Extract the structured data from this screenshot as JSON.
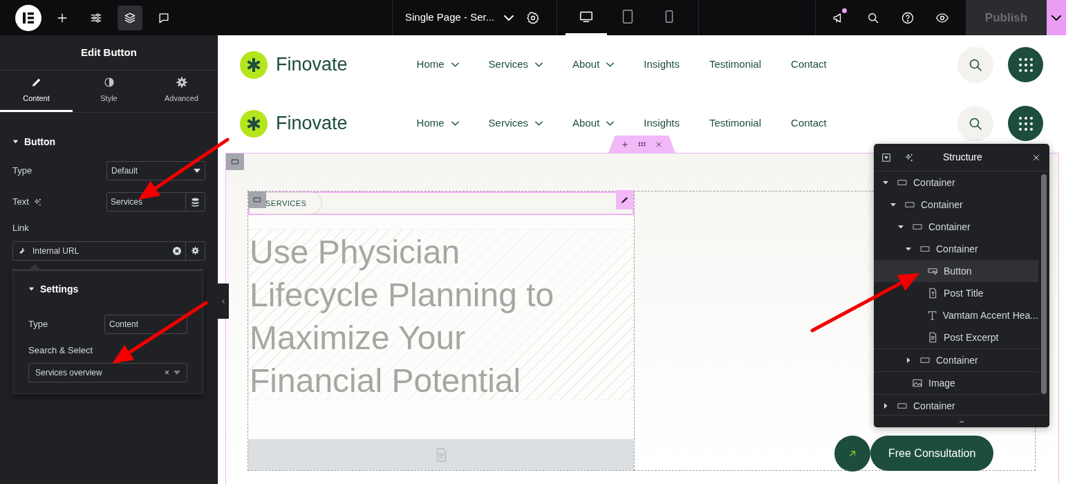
{
  "top_bar": {
    "tools": [
      {
        "kind": "add",
        "selected": false
      },
      {
        "kind": "sliders",
        "selected": false
      },
      {
        "kind": "layers",
        "selected": true
      },
      {
        "kind": "comments",
        "selected": false
      }
    ],
    "page_title": "Single Page - Ser...",
    "devices": [
      {
        "kind": "desktop",
        "selected": true
      },
      {
        "kind": "tablet",
        "selected": false
      },
      {
        "kind": "mobile",
        "selected": false
      }
    ],
    "has_notification": true,
    "publish": {
      "label": "Publish",
      "disabled": true
    }
  },
  "panel": {
    "title": "Edit Button",
    "tabs": [
      {
        "kind": "content",
        "label": "Content",
        "selected": true
      },
      {
        "kind": "style",
        "label": "Style",
        "selected": false
      },
      {
        "kind": "advanced",
        "label": "Advanced",
        "selected": false
      }
    ],
    "section": {
      "title": "Button",
      "expanded": true
    },
    "type": {
      "label": "Type",
      "value": "Default"
    },
    "text": {
      "label": "Text",
      "value": "Services"
    },
    "link": {
      "label": "Link",
      "value": "Internal URL"
    },
    "settings": {
      "title": "Settings",
      "expanded": true,
      "type": {
        "label": "Type",
        "value": "Content"
      },
      "search": {
        "label": "Search & Select",
        "value": "Services overview",
        "clear": "×"
      }
    }
  },
  "headers": [
    {
      "logo": "Finovate",
      "nav": [
        {
          "label": "Home",
          "has_dropdown": true
        },
        {
          "label": "Services",
          "has_dropdown": true
        },
        {
          "label": "About",
          "has_dropdown": true
        },
        {
          "label": "Insights",
          "has_dropdown": false
        },
        {
          "label": "Testimonial",
          "has_dropdown": false
        },
        {
          "label": "Contact",
          "has_dropdown": false
        }
      ]
    },
    {
      "logo": "Finovate",
      "nav": [
        {
          "label": "Home",
          "has_dropdown": true
        },
        {
          "label": "Services",
          "has_dropdown": true
        },
        {
          "label": "About",
          "has_dropdown": true
        },
        {
          "label": "Insights",
          "has_dropdown": false
        },
        {
          "label": "Testimonial",
          "has_dropdown": false
        },
        {
          "label": "Contact",
          "has_dropdown": false
        }
      ]
    }
  ],
  "section": {
    "tag": "SERVICES",
    "heading": "Use Physician Lifecycle Planning to Maximize Your Financial Potential",
    "cta": "Free Consultation"
  },
  "structure": {
    "title": "Structure",
    "tree": [
      {
        "label": "Container",
        "kind": "container",
        "expanded": true,
        "selected": false,
        "children": [
          {
            "label": "Container",
            "kind": "container",
            "expanded": true,
            "selected": false,
            "children": [
              {
                "label": "Container",
                "kind": "container",
                "expanded": true,
                "selected": false,
                "children": [
                  {
                    "label": "Container",
                    "kind": "container",
                    "expanded": true,
                    "selected": false,
                    "children": [
                      {
                        "label": "Button",
                        "kind": "button",
                        "selected": true
                      },
                      {
                        "label": "Post Title",
                        "kind": "post-title",
                        "selected": false
                      },
                      {
                        "label": "Vamtam Accent Hea...",
                        "kind": "heading",
                        "selected": false
                      },
                      {
                        "label": "Post Excerpt",
                        "kind": "post-excerpt",
                        "selected": false
                      }
                    ]
                  },
                  {
                    "label": "Container",
                    "kind": "container",
                    "expanded": false,
                    "selected": false
                  }
                ]
              },
              {
                "label": "Image",
                "kind": "image",
                "selected": false
              }
            ]
          }
        ]
      },
      {
        "label": "Container",
        "kind": "container",
        "expanded": false,
        "selected": false
      }
    ]
  }
}
